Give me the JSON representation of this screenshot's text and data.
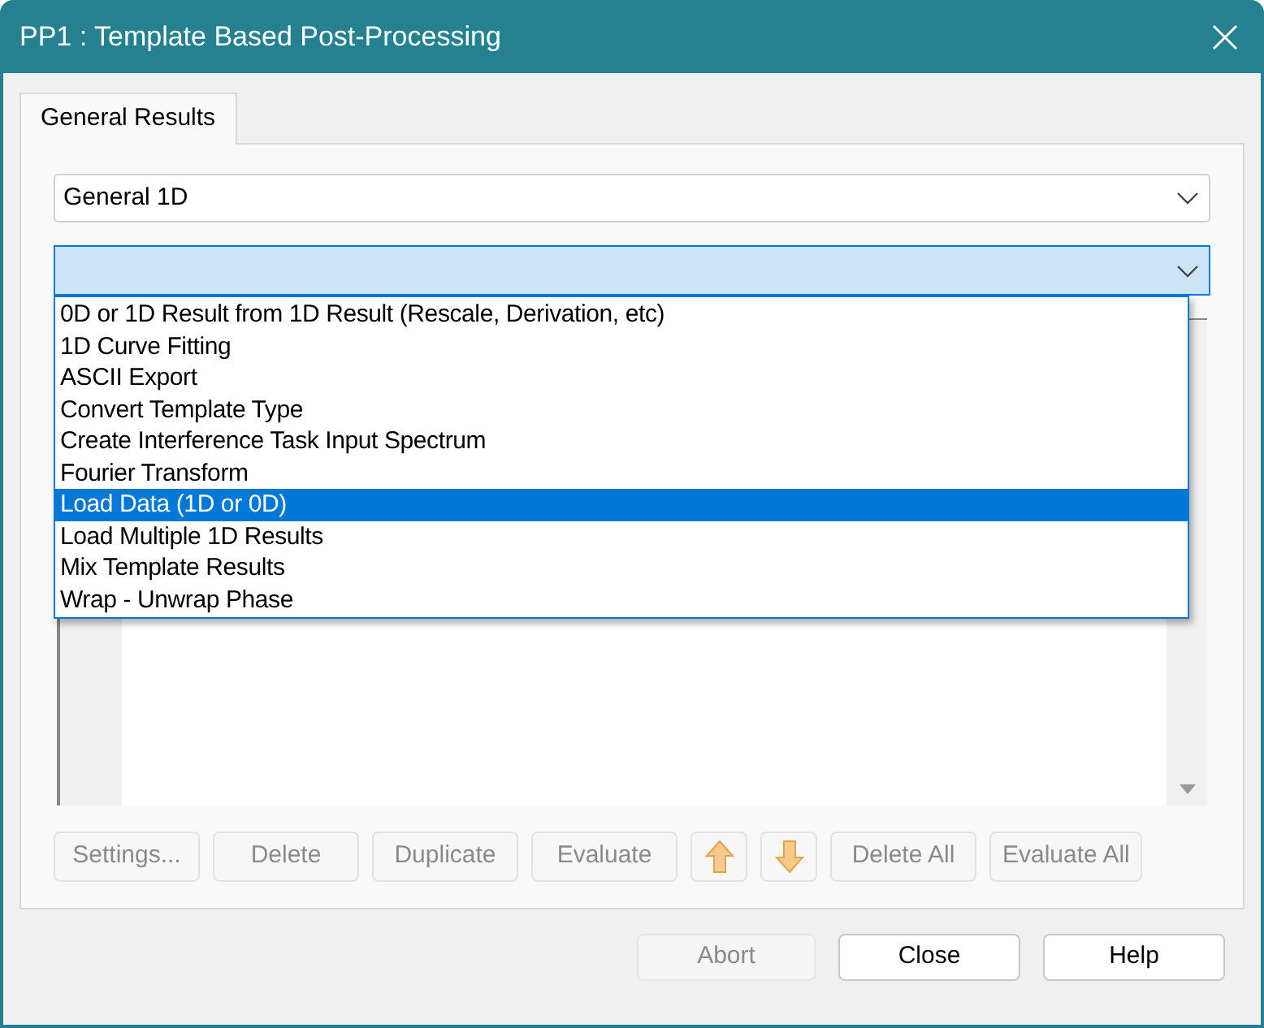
{
  "window": {
    "title": "PP1 : Template Based Post-Processing"
  },
  "tabs": [
    {
      "label": "General Results",
      "selected": true
    }
  ],
  "category_select": {
    "value": "General 1D"
  },
  "template_select": {
    "expanded": true,
    "options": [
      {
        "label": "0D or 1D Result from 1D Result (Rescale, Derivation, etc)",
        "selected": false
      },
      {
        "label": "1D Curve Fitting",
        "selected": false
      },
      {
        "label": "ASCII Export",
        "selected": false
      },
      {
        "label": "Convert Template Type",
        "selected": false
      },
      {
        "label": "Create Interference Task Input Spectrum",
        "selected": false
      },
      {
        "label": "Fourier Transform",
        "selected": false
      },
      {
        "label": "Load Data (1D or 0D)",
        "selected": true
      },
      {
        "label": "Load Multiple 1D Results",
        "selected": false
      },
      {
        "label": "Mix Template Results",
        "selected": false
      },
      {
        "label": "Wrap - Unwrap Phase",
        "selected": false
      }
    ]
  },
  "actions": [
    {
      "kind": "text",
      "label": "Settings...",
      "disabled": true
    },
    {
      "kind": "text",
      "label": "Delete",
      "disabled": true
    },
    {
      "kind": "text",
      "label": "Duplicate",
      "disabled": true
    },
    {
      "kind": "text",
      "label": "Evaluate",
      "disabled": true
    },
    {
      "kind": "arrow-up",
      "disabled": false
    },
    {
      "kind": "arrow-down",
      "disabled": false
    },
    {
      "kind": "text",
      "label": "Delete All",
      "disabled": true
    },
    {
      "kind": "text",
      "label": "Evaluate All",
      "disabled": true
    }
  ],
  "footer_buttons": [
    {
      "label": "Abort",
      "disabled": true
    },
    {
      "label": "Close",
      "disabled": false
    },
    {
      "label": "Help",
      "disabled": false
    }
  ]
}
